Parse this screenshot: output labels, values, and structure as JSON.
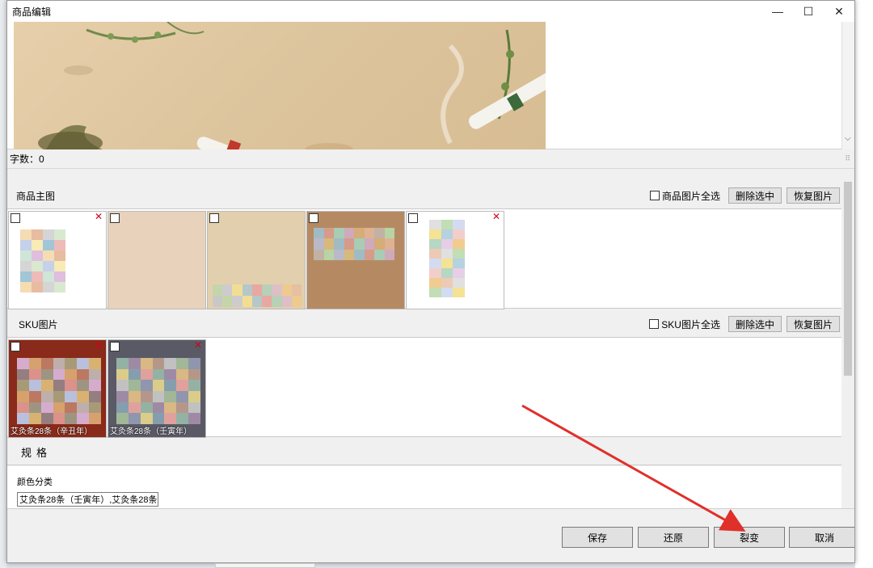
{
  "window": {
    "title": "商品编辑",
    "minimize_glyph": "—",
    "maximize_glyph": "☐",
    "close_glyph": "✕"
  },
  "editor": {
    "word_count_label": "字数：0"
  },
  "main_images": {
    "section_label": "商品主图",
    "select_all_label": "商品图片全选",
    "delete_selected_label": "删除选中",
    "restore_label": "恢复图片",
    "remove_glyph": "✕",
    "thumbnails": [
      {
        "name": "main-image-1",
        "bg": "#ffffff"
      },
      {
        "name": "main-image-2",
        "bg": "#e8d2bb"
      },
      {
        "name": "main-image-3",
        "bg": "#e2cfae"
      },
      {
        "name": "main-image-4",
        "bg": "#b58a63"
      },
      {
        "name": "main-image-5",
        "bg": "#ffffff"
      }
    ]
  },
  "sku_images": {
    "section_label": "SKU图片",
    "select_all_label": "SKU图片全选",
    "delete_selected_label": "删除选中",
    "restore_label": "恢复图片",
    "remove_glyph": "✕",
    "thumbnails": [
      {
        "caption": "艾灸条28条（辛丑年）",
        "bg": "#8a2a1a"
      },
      {
        "caption": "艾灸条28条（壬寅年）",
        "bg": "#5a5a66"
      }
    ]
  },
  "spec": {
    "section_label": "规格",
    "color_label": "颜色分类",
    "color_value": "艾灸条28条（壬寅年）,艾灸条28条",
    "dropdown_glyph": "⌵"
  },
  "footer": {
    "save_label": "保存",
    "restore_label": "还原",
    "clone_label": "裂变",
    "cancel_label": "取消"
  },
  "colors": {
    "annotation_arrow": "#e0302a",
    "remove_icon": "#d0021b"
  }
}
